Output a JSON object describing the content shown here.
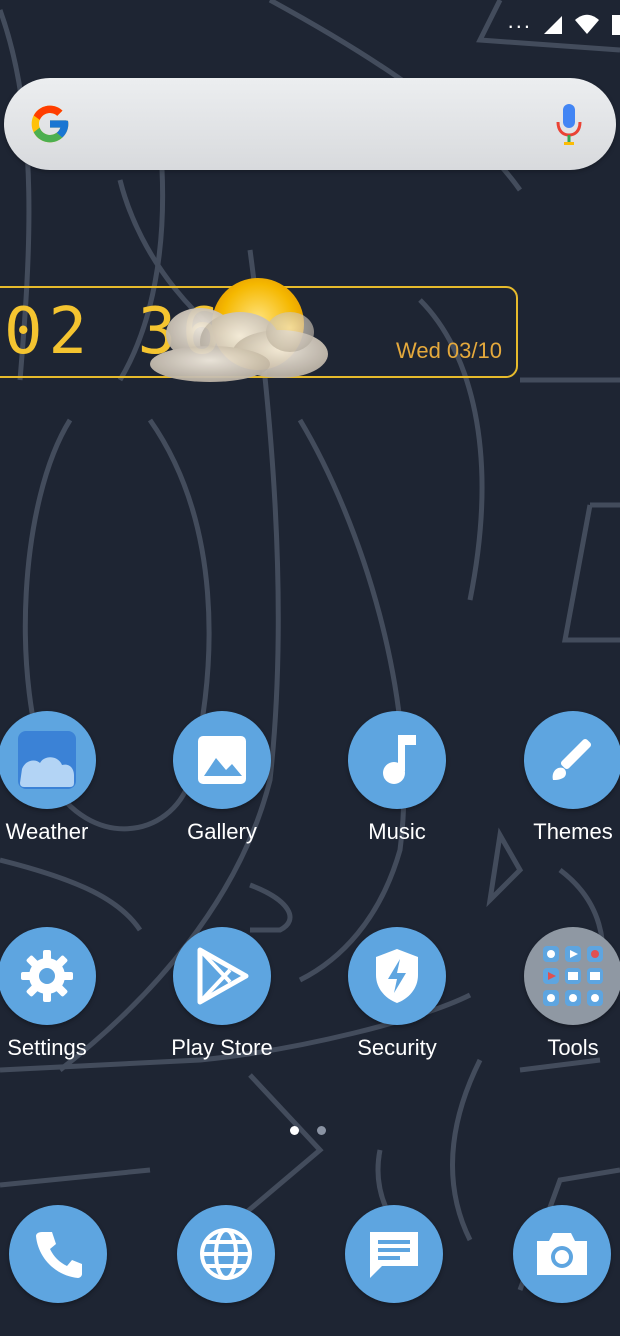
{
  "status_bar": {
    "dots": "...",
    "icons": [
      "signal-icon",
      "wifi-icon",
      "battery-icon"
    ]
  },
  "search": {
    "logo": "google-logo",
    "mic": "mic-icon"
  },
  "clock_widget": {
    "time": "02 36",
    "date": "Wed 03/10",
    "weather_icon": "partly-cloudy-icon",
    "accent": "#f4c430"
  },
  "apps_row1": [
    {
      "label": "Weather",
      "icon": "weather-icon"
    },
    {
      "label": "Gallery",
      "icon": "gallery-icon"
    },
    {
      "label": "Music",
      "icon": "music-note-icon"
    },
    {
      "label": "Themes",
      "icon": "paintbrush-icon"
    }
  ],
  "apps_row2": [
    {
      "label": "Settings",
      "icon": "gear-icon"
    },
    {
      "label": "Play Store",
      "icon": "play-store-icon"
    },
    {
      "label": "Security",
      "icon": "security-shield-icon"
    },
    {
      "label": "Tools",
      "icon": "folder-icon"
    }
  ],
  "page_indicator": {
    "pages": 2,
    "current": 1
  },
  "dock": [
    "phone-icon",
    "browser-icon",
    "messages-icon",
    "camera-icon"
  ],
  "colors": {
    "background": "#1e2533",
    "icon_bg": "#5ea5e0",
    "text": "#ffffff"
  }
}
